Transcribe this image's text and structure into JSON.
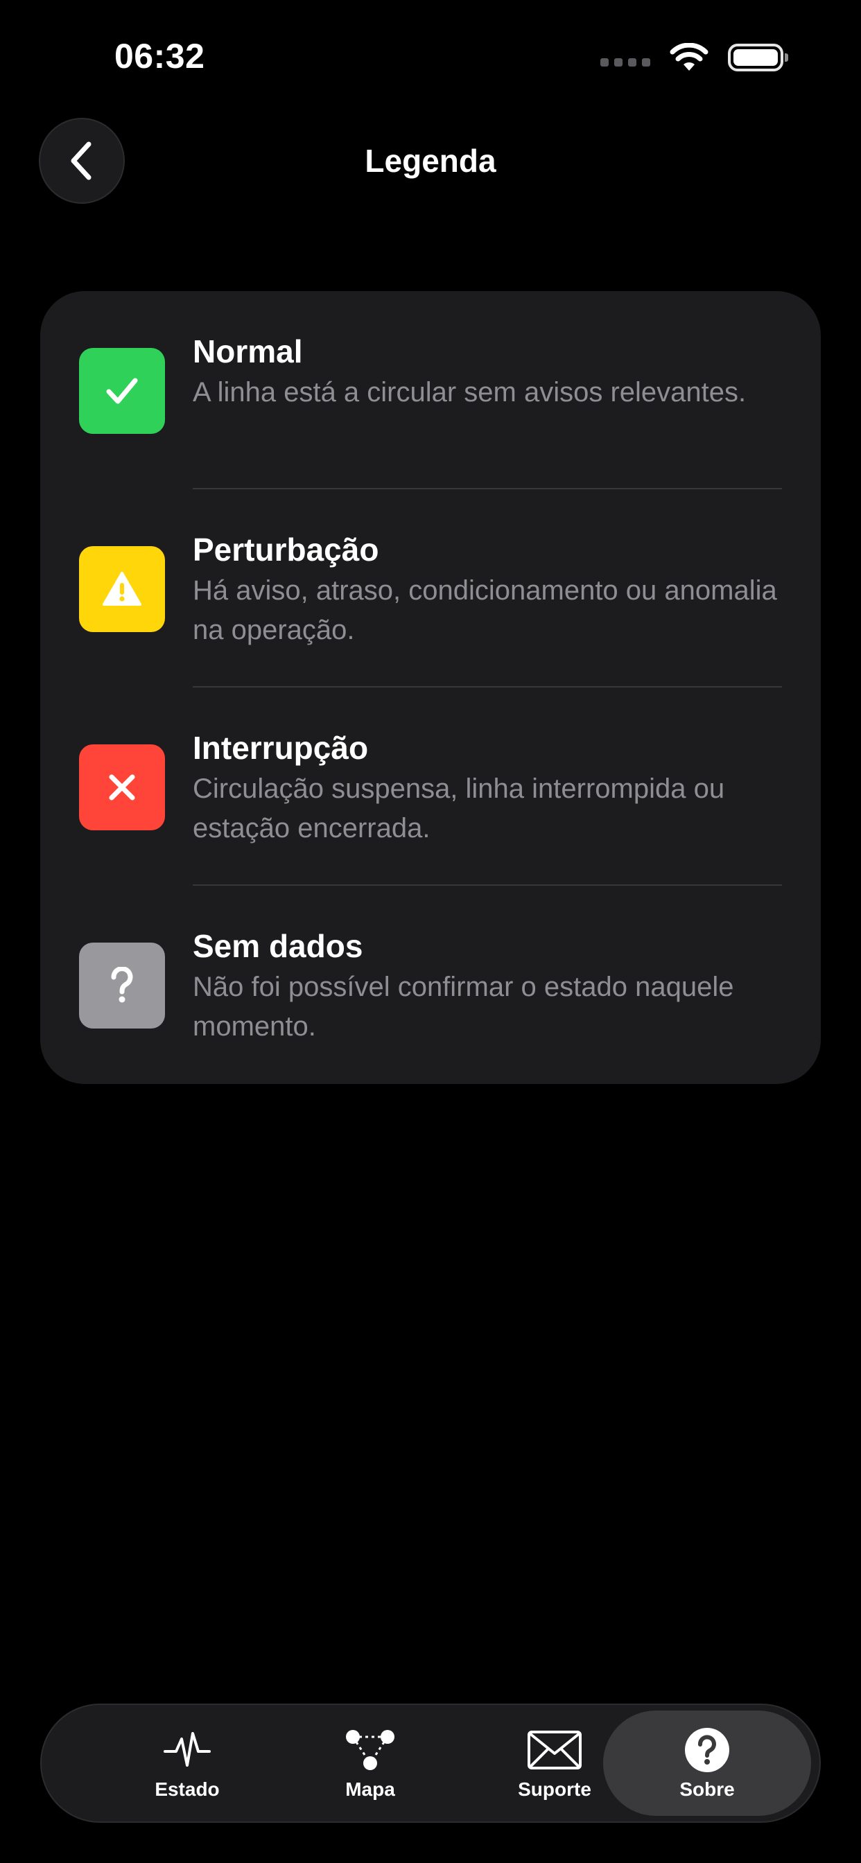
{
  "status_bar": {
    "time": "06:32"
  },
  "nav": {
    "title": "Legenda",
    "back_icon": "chevron-left-icon"
  },
  "legend": {
    "items": [
      {
        "title": "Normal",
        "description": "A linha está a circular sem avisos relevantes.",
        "color": "#30d158",
        "icon": "checkmark-icon"
      },
      {
        "title": "Perturbação",
        "description": "Há aviso, atraso, condicionamento ou anomalia na operação.",
        "color": "#ffd60a",
        "icon": "warning-icon"
      },
      {
        "title": "Interrupção",
        "description": "Circulação suspensa, linha interrompida ou estação encerrada.",
        "color": "#ff453a",
        "icon": "x-mark-icon"
      },
      {
        "title": "Sem dados",
        "description": "Não foi possível confirmar o estado naquele momento.",
        "color": "#98989d",
        "icon": "question-mark-icon"
      }
    ]
  },
  "tabbar": {
    "tabs": [
      {
        "label": "Estado",
        "icon": "pulse-icon",
        "active": false
      },
      {
        "label": "Mapa",
        "icon": "network-map-icon",
        "active": false
      },
      {
        "label": "Suporte",
        "icon": "envelope-icon",
        "active": false
      },
      {
        "label": "Sobre",
        "icon": "question-circle-icon",
        "active": true
      }
    ]
  }
}
